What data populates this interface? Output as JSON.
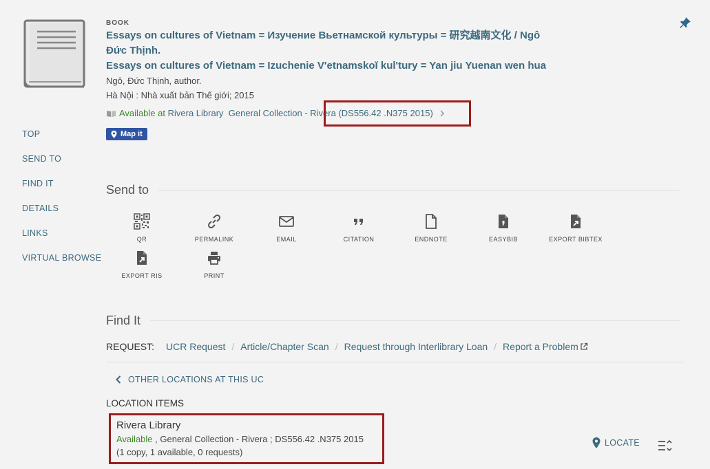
{
  "record": {
    "type": "BOOK",
    "title_line1": "Essays on cultures of Vietnam = Изучение Вьетнамской культуры = 研究越南文化 / Ngô",
    "title_line2": "Đức Thịnh.",
    "alt_title": "Essays on cultures of Vietnam = Izuchenie V'etnamskoĭ kul'tury = Yan jiu Yuenan wen hua",
    "author": "Ngô, Đức Thịnh, author.",
    "publication": "Hà Nội : Nhà xuất bản Thế giới; 2015",
    "availability": {
      "status": "Available at",
      "library": "Rivera Library",
      "collection": "General Collection",
      "dash": " - ",
      "call_location": "Rivera (DS556.42 .N375 2015)"
    },
    "map_it_label": "Map it"
  },
  "side_nav": {
    "items": [
      "TOP",
      "SEND TO",
      "FIND IT",
      "DETAILS",
      "LINKS",
      "VIRTUAL BROWSE"
    ]
  },
  "send_to": {
    "heading": "Send to",
    "actions": [
      "QR",
      "PERMALINK",
      "EMAIL",
      "CITATION",
      "ENDNOTE",
      "EASYBIB",
      "EXPORT BIBTEX",
      "EXPORT RIS",
      "PRINT"
    ]
  },
  "find_it": {
    "heading": "Find It",
    "request_label": "REQUEST:",
    "request_links": [
      "UCR Request",
      "Article/Chapter Scan",
      "Request through Interlibrary Loan",
      "Report a Problem"
    ],
    "other_locations": "OTHER LOCATIONS AT THIS UC",
    "location_items_label": "LOCATION ITEMS",
    "location": {
      "name": "Rivera Library",
      "status": "Available",
      "details": " , General Collection - Rivera ; DS556.42 .N375 2015",
      "copies": "(1 copy, 1 available, 0 requests)"
    },
    "locate_label": "LOCATE"
  },
  "colors": {
    "link": "#3d6a7e",
    "available": "#3d8a2c",
    "highlight": "#9d1b1b",
    "map_button": "#2e55a3"
  }
}
